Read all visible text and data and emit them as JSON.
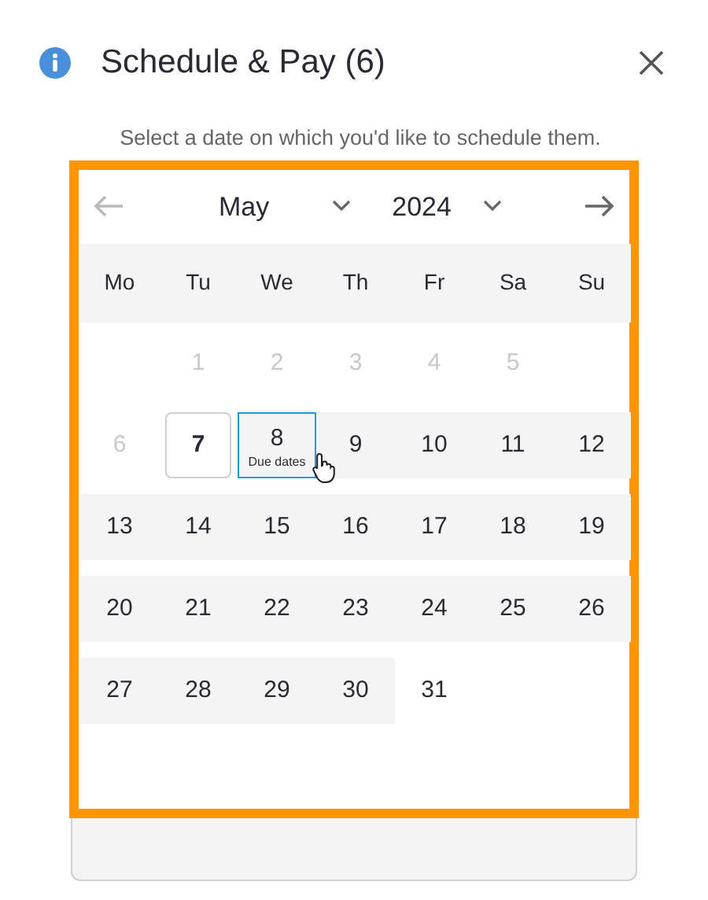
{
  "dialog": {
    "title": "Schedule & Pay (6)",
    "instruction": "Select a date on which you'd like to schedule them."
  },
  "calendar": {
    "month": "May",
    "year": "2024",
    "weekdays": [
      "Mo",
      "Tu",
      "We",
      "Th",
      "Fr",
      "Sa",
      "Su"
    ],
    "weeks": [
      [
        {
          "kind": "blank"
        },
        {
          "day": "1",
          "kind": "disabled"
        },
        {
          "day": "2",
          "kind": "disabled"
        },
        {
          "day": "3",
          "kind": "disabled"
        },
        {
          "day": "4",
          "kind": "disabled"
        },
        {
          "day": "5",
          "kind": "disabled"
        }
      ],
      [
        {
          "day": "6",
          "kind": "disabled"
        },
        {
          "day": "7",
          "kind": "today"
        },
        {
          "day": "8",
          "kind": "available",
          "hovered": true,
          "note": "Due dates"
        },
        {
          "day": "9",
          "kind": "available"
        },
        {
          "day": "10",
          "kind": "available"
        },
        {
          "day": "11",
          "kind": "available"
        },
        {
          "day": "12",
          "kind": "available"
        }
      ],
      [
        {
          "day": "13",
          "kind": "available"
        },
        {
          "day": "14",
          "kind": "available"
        },
        {
          "day": "15",
          "kind": "available"
        },
        {
          "day": "16",
          "kind": "available"
        },
        {
          "day": "17",
          "kind": "available"
        },
        {
          "day": "18",
          "kind": "available"
        },
        {
          "day": "19",
          "kind": "available"
        }
      ],
      [
        {
          "day": "20",
          "kind": "available"
        },
        {
          "day": "21",
          "kind": "available"
        },
        {
          "day": "22",
          "kind": "available"
        },
        {
          "day": "23",
          "kind": "available"
        },
        {
          "day": "24",
          "kind": "available"
        },
        {
          "day": "25",
          "kind": "available"
        },
        {
          "day": "26",
          "kind": "available"
        }
      ],
      [
        {
          "day": "27",
          "kind": "available"
        },
        {
          "day": "28",
          "kind": "available"
        },
        {
          "day": "29",
          "kind": "available"
        },
        {
          "day": "30",
          "kind": "available"
        },
        {
          "day": "31",
          "kind": "plain"
        }
      ]
    ]
  }
}
